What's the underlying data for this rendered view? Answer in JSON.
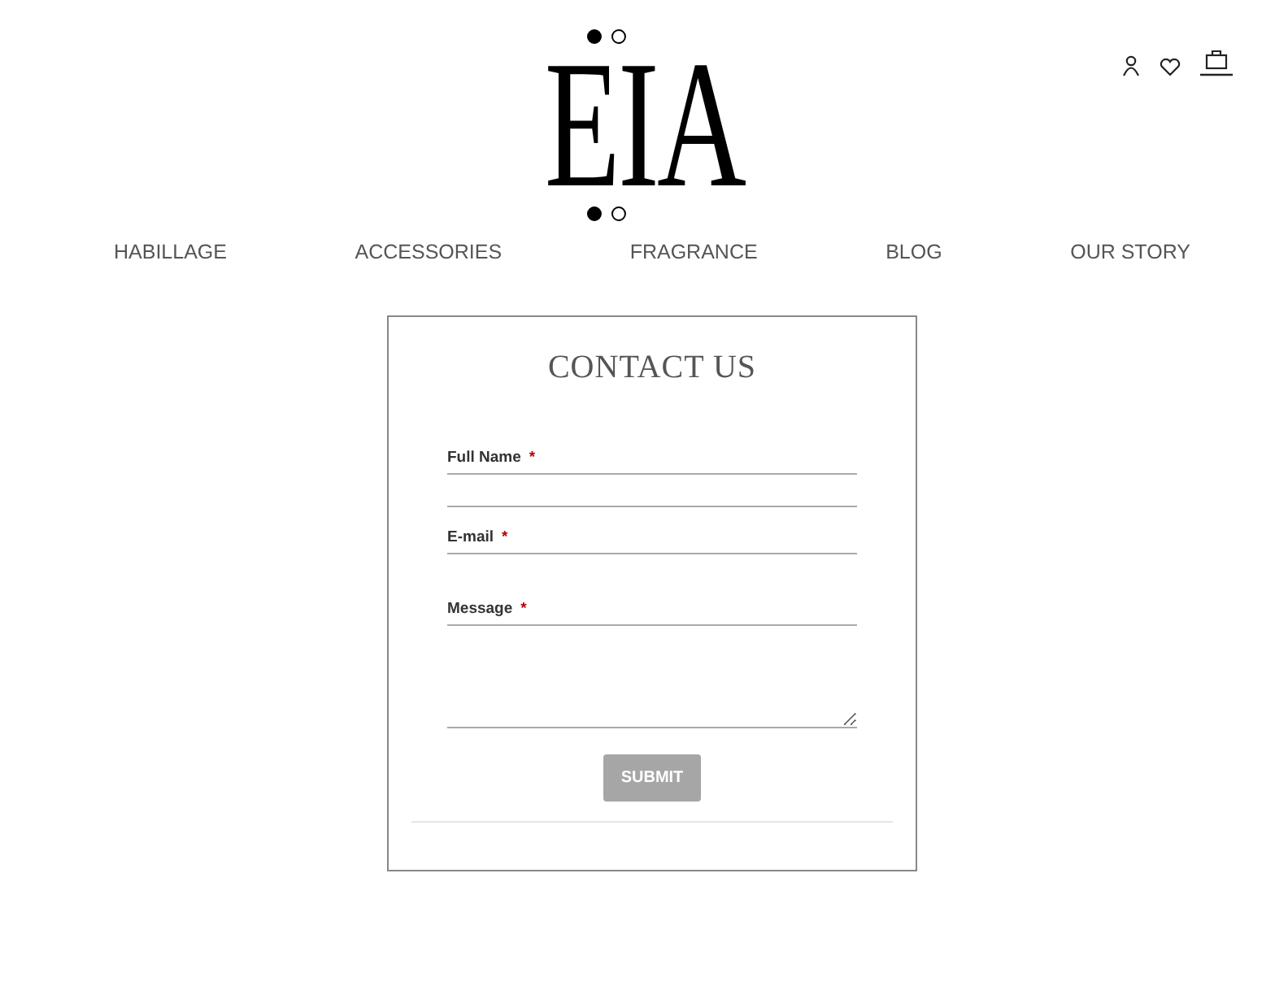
{
  "logo": {
    "text": "EIA"
  },
  "nav": [
    {
      "label": "HABILLAGE"
    },
    {
      "label": "ACCESSORIES"
    },
    {
      "label": "FRAGRANCE"
    },
    {
      "label": "BLOG"
    },
    {
      "label": "OUR STORY"
    }
  ],
  "form": {
    "title": "CONTACT US",
    "fields": [
      {
        "label": "Full Name",
        "mark": "*",
        "kind": "line"
      },
      {
        "label": "E-mail",
        "mark": "*",
        "kind": "line"
      },
      {
        "label": "Message",
        "mark": "*",
        "kind": "area"
      }
    ],
    "submit": "SUBMIT"
  }
}
